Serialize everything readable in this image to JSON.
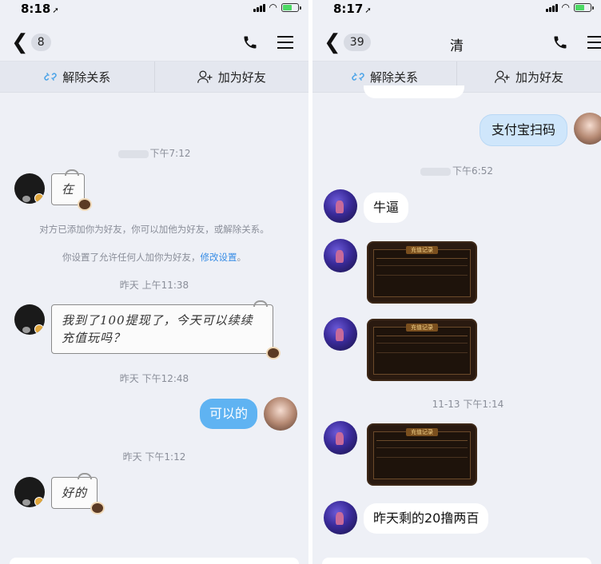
{
  "left": {
    "status": {
      "time": "8:18"
    },
    "nav": {
      "back_count": "8",
      "title": ""
    },
    "actions": {
      "unfriend": "解除关系",
      "add_friend": "加为好友"
    },
    "messages": {
      "ts1": "下午7:12",
      "msg1": "在",
      "sys1": "对方已添加你为好友，你可以加他为好友，或解除关系。",
      "sys2": "你设置了允许任何人加你为好友，",
      "sys2_link": "修改设置",
      "sys2_end": "。",
      "ts2": "昨天 上午11:38",
      "msg2": "我到了100提现了，今天可以续续充值玩吗？",
      "ts3": "昨天 下午12:48",
      "msg3": "可以的",
      "ts4": "昨天 下午1:12",
      "msg4": "好的"
    }
  },
  "right": {
    "status": {
      "time": "8:17"
    },
    "nav": {
      "back_count": "39",
      "title": "清"
    },
    "actions": {
      "unfriend": "解除关系",
      "add_friend": "加为好友"
    },
    "messages": {
      "msg1": "支付宝扫码",
      "ts1": "下午6:52",
      "msg2": "牛逼",
      "img_title": "充值记录",
      "ts2": "11-13 下午1:14",
      "msg3": "昨天剩的20撸两百"
    }
  },
  "colors": {
    "accent_blue": "#5fb3f2",
    "link": "#3a8ee6",
    "background": "#eef0f6"
  },
  "icons": [
    "back-chevron-icon",
    "phone-icon",
    "menu-icon",
    "unlink-icon",
    "add-friend-icon"
  ]
}
